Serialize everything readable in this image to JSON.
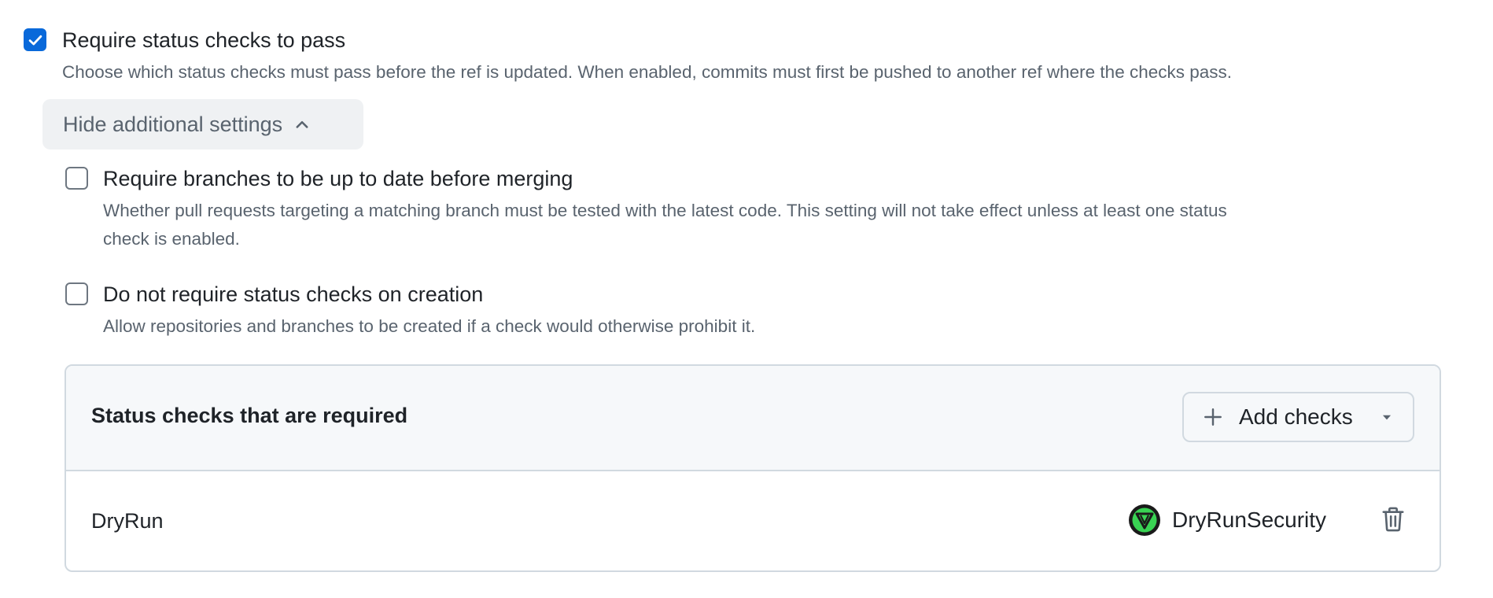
{
  "status_checks": {
    "label": "Require status checks to pass",
    "description": "Choose which status checks must pass before the ref is updated. When enabled, commits must first be pushed to another ref where the checks pass.",
    "checked": true
  },
  "toggle_settings": {
    "label": "Hide additional settings",
    "icon": "chevron-up-icon"
  },
  "up_to_date": {
    "label": "Require branches to be up to date before merging",
    "description_line1": "Whether pull requests targeting a matching branch must be tested with the latest code. This setting will not take effect unless at least one status",
    "description_line2": "check is enabled.",
    "checked": false
  },
  "on_creation": {
    "label": "Do not require status checks on creation",
    "description": "Allow repositories and branches to be created if a check would otherwise prohibit it.",
    "checked": false
  },
  "required_checks": {
    "title": "Status checks that are required",
    "add_button_label": "Add checks",
    "rows": [
      {
        "name": "DryRun",
        "app_name": "DryRunSecurity",
        "app_icon": "dryrunsecurity-logo-icon"
      }
    ]
  },
  "colors": {
    "accent": "#0969da",
    "muted_text": "#59636e",
    "border": "#d1d9e0",
    "logo_green": "#39d353"
  }
}
